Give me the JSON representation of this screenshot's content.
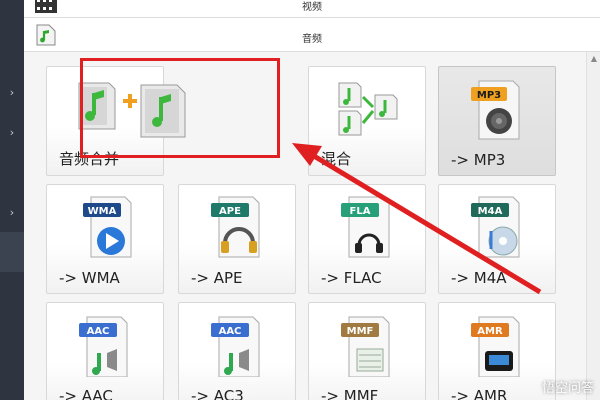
{
  "categories": [
    {
      "label": "视频",
      "icon": "film-icon"
    },
    {
      "label": "音频",
      "icon": "music-file-icon"
    }
  ],
  "tiles": [
    {
      "label": "音频合并",
      "icon": "audio-merge-icon",
      "selected": false
    },
    {
      "label": "混合",
      "icon": "audio-mix-icon",
      "selected": false
    },
    {
      "label": "-> MP3",
      "icon": "mp3-icon",
      "badge": "MP3",
      "badge_color": "#f0a020",
      "selected": true
    },
    {
      "label": "-> WMA",
      "icon": "wma-icon",
      "badge": "WMA",
      "badge_color": "#1e4a8c",
      "selected": false
    },
    {
      "label": "-> APE",
      "icon": "ape-icon",
      "badge": "APE",
      "badge_color": "#1f7a6a",
      "selected": false
    },
    {
      "label": "-> FLAC",
      "icon": "flac-icon",
      "badge": "FLA",
      "badge_color": "#27a07a",
      "selected": false
    },
    {
      "label": "-> M4A",
      "icon": "m4a-icon",
      "badge": "M4A",
      "badge_color": "#1f6a5a",
      "selected": false
    },
    {
      "label": "-> AAC",
      "icon": "aac-icon",
      "badge": "AAC",
      "badge_color": "#3a6fd0",
      "selected": false
    },
    {
      "label": "-> AC3",
      "icon": "ac3-icon",
      "badge": "AAC",
      "badge_color": "#3a6fd0",
      "selected": false
    },
    {
      "label": "-> MMF",
      "icon": "mmf-icon",
      "badge": "MMF",
      "badge_color": "#a07a40",
      "selected": false
    },
    {
      "label": "-> AMR",
      "icon": "amr-icon",
      "badge": "AMR",
      "badge_color": "#e07a20",
      "selected": false
    }
  ],
  "annotation": {
    "box_color": "#e02020",
    "arrow_color": "#e02020"
  },
  "watermark": "悟空问答"
}
